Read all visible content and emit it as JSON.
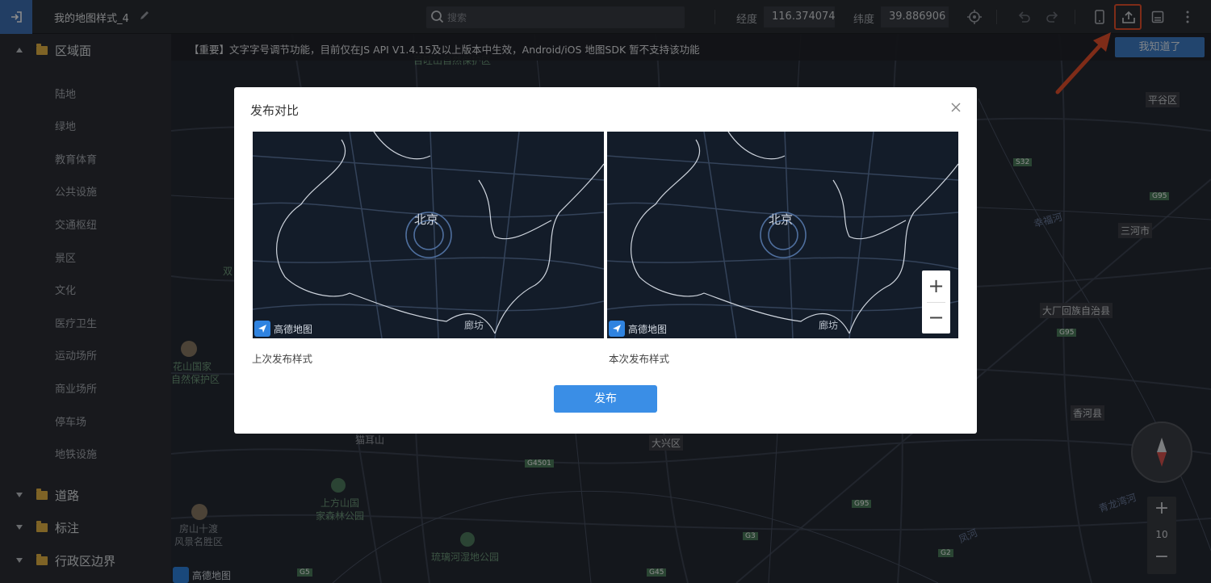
{
  "topbar": {
    "title": "我的地图样式_4",
    "search_placeholder": "搜索",
    "lng_label": "经度",
    "lng_value": "116.374074",
    "lat_label": "纬度",
    "lat_value": "39.886906"
  },
  "sidebar": {
    "sections": [
      {
        "name": "区域面",
        "expanded": true
      },
      {
        "name": "道路",
        "expanded": false
      },
      {
        "name": "标注",
        "expanded": false
      },
      {
        "name": "行政区边界",
        "expanded": false
      }
    ],
    "items": [
      "陆地",
      "绿地",
      "教育体育",
      "公共设施",
      "交通枢纽",
      "景区",
      "文化",
      "医疗卫生",
      "运动场所",
      "商业场所",
      "停车场",
      "地铁设施"
    ]
  },
  "notice": {
    "text": "【重要】文字字号调节功能，目前仅在JS API V1.4.15及以上版本中生效，Android/iOS 地图SDK 暂不支持该功能",
    "button": "我知道了"
  },
  "map_labels": {
    "pinggu": "平谷区",
    "sanhe": "三河市",
    "dachang": "大厂回族自治县",
    "xianghe": "香河县",
    "daxing": "大兴区",
    "maoershan": "猫耳山",
    "huashan_1": "花山国家",
    "huashan_2": "自然保护区",
    "shangfang_1": "上方山国",
    "shangfang_2": "家森林公园",
    "fangshan_1": "房山十渡",
    "fangshan_2": "风景名胜区",
    "liuli": "琉璃河湿地公园",
    "xingfu": "幸福河",
    "qinglong": "青龙湾河",
    "fenghe": "凤河",
    "top_cut": "百旺山自然保护区",
    "left_cut": "双",
    "roads": [
      "S32",
      "G95",
      "G95",
      "G4501",
      "G95",
      "G3",
      "G2",
      "G45",
      "G5"
    ],
    "zoom_level": "10"
  },
  "modal": {
    "title": "发布对比",
    "left_caption": "上次发布样式",
    "right_caption": "本次发布样式",
    "publish_button": "发布",
    "city_label": "北京",
    "langfang_label": "廊坊",
    "logo_text": "高德地图"
  },
  "colors": {
    "accent": "#3a8ee6",
    "highlight": "#e8502d",
    "sidebar_bg": "#2c2f35",
    "map_bg": "#262a33"
  }
}
